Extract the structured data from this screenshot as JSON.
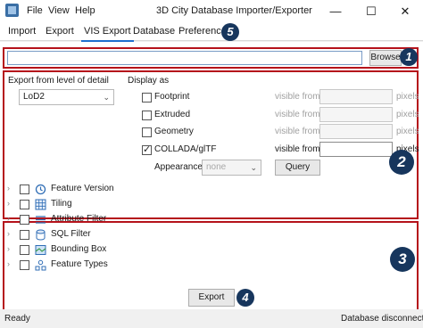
{
  "window": {
    "title": "3D City Database Importer/Exporter",
    "menu": [
      "File",
      "View",
      "Help"
    ],
    "minimize": "—",
    "maximize": "☐",
    "close": "✕"
  },
  "tabs": [
    "Import",
    "Export",
    "VIS Export",
    "Database",
    "Preferences"
  ],
  "active_tab": "VIS Export",
  "badges": [
    "1",
    "2",
    "3",
    "4",
    "5"
  ],
  "output": {
    "browse_label": "Browse",
    "path_value": ""
  },
  "lod": {
    "label": "Export from level of detail",
    "selected": "LoD2"
  },
  "display": {
    "label": "Display as",
    "items": [
      {
        "label": "Footprint",
        "checked": false,
        "visible_from": "visible from",
        "value": "",
        "unit": "pixels"
      },
      {
        "label": "Extruded",
        "checked": false,
        "visible_from": "visible from",
        "value": "",
        "unit": "pixels"
      },
      {
        "label": "Geometry",
        "checked": false,
        "visible_from": "visible from",
        "value": "",
        "unit": "pixels"
      },
      {
        "label": "COLLADA/glTF",
        "checked": true,
        "visible_from": "visible from",
        "value": "",
        "unit": "pixels"
      }
    ],
    "appearance_label": "Appearance",
    "appearance_value": "none",
    "query_label": "Query"
  },
  "filters": [
    {
      "label": "Feature Version",
      "icon": "clock-icon"
    },
    {
      "label": "Tiling",
      "icon": "grid-icon"
    },
    {
      "label": "Attribute Filter",
      "icon": "filter-icon"
    },
    {
      "label": "SQL Filter",
      "icon": "database-icon"
    },
    {
      "label": "Bounding Box",
      "icon": "map-icon"
    },
    {
      "label": "Feature Types",
      "icon": "feature-types-icon"
    }
  ],
  "export_button": "Export",
  "status": {
    "left": "Ready",
    "right": "Database disconnected"
  },
  "colors": {
    "highlight_box": "#b5121b",
    "badge": "#17365d",
    "active_tab_underline": "#1e6fcf"
  }
}
